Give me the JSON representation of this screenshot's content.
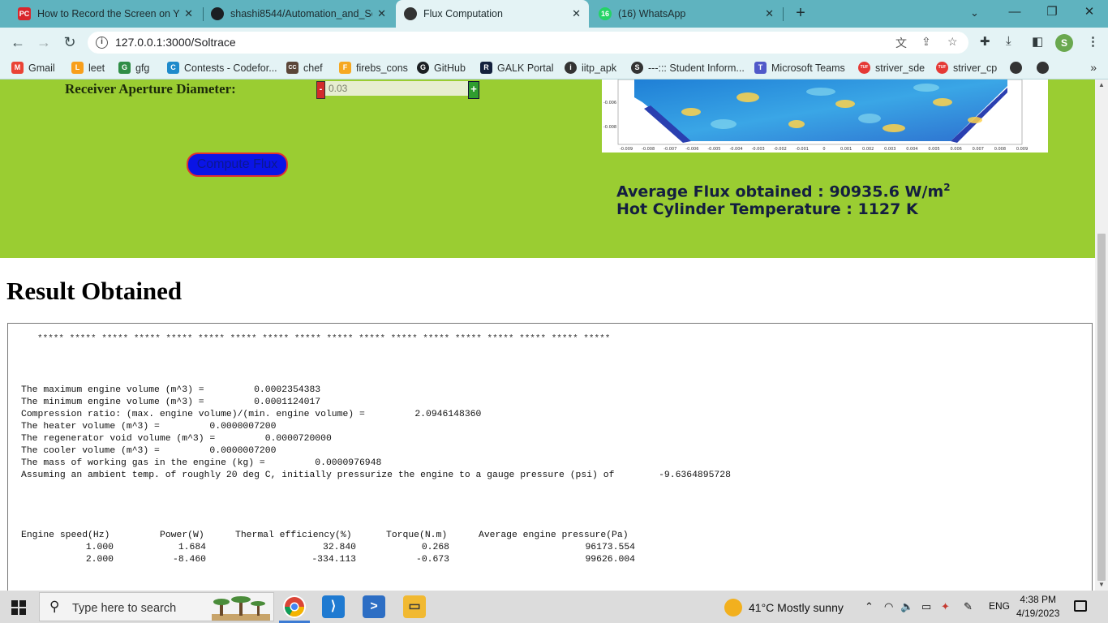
{
  "browser": {
    "tabs": [
      {
        "title": "How to Record the Screen on Yo",
        "favicon_text": "PC",
        "favicon_color": "#d9262c"
      },
      {
        "title": "shashi8544/Automation_and_Sol",
        "favicon_text": "",
        "favicon_color": "#1b1f23"
      },
      {
        "title": "Flux Computation",
        "favicon_text": "",
        "favicon_color": "#333333"
      },
      {
        "title": "(16) WhatsApp",
        "favicon_text": "16",
        "favicon_color": "#25d366"
      }
    ],
    "url": "127.0.0.1:3000/Soltrace",
    "profile_initial": "S",
    "bookmarks": [
      {
        "label": "Gmail",
        "icon": "M",
        "color": "#ea4335"
      },
      {
        "label": "leet",
        "icon": "L",
        "color": "#f89f1b"
      },
      {
        "label": "gfg",
        "icon": "G",
        "color": "#2f8d46"
      },
      {
        "label": "Contests - Codefor...",
        "icon": "C",
        "color": "#1f8acb"
      },
      {
        "label": "chef",
        "icon": "CC",
        "color": "#5b4638"
      },
      {
        "label": "firebs_cons",
        "icon": "F",
        "color": "#f6a821"
      },
      {
        "label": "GitHub",
        "icon": "G",
        "color": "#1b1f23"
      },
      {
        "label": "GALK Portal",
        "icon": "R",
        "color": "#14213d"
      },
      {
        "label": "iitp_apk",
        "icon": "i",
        "color": "#333333"
      },
      {
        "label": "---::: Student Inform...",
        "icon": "S",
        "color": "#333333"
      },
      {
        "label": "Microsoft Teams",
        "icon": "T",
        "color": "#5059c9"
      },
      {
        "label": "striver_sde",
        "icon": "TUF",
        "color": "#e53935"
      },
      {
        "label": "striver_cp",
        "icon": "TUF",
        "color": "#e53935"
      }
    ]
  },
  "form": {
    "aperture_label": "Receiver Aperture Diameter:",
    "aperture_value": "0.03",
    "stepper_minus": "-",
    "stepper_plus": "+",
    "compute_button": "Compute Flux"
  },
  "plot": {
    "y_ticks": [
      "-0.006",
      "-0.008"
    ],
    "x_ticks": [
      "-0.009",
      "-0.008",
      "-0.007",
      "-0.006",
      "-0.005",
      "-0.004",
      "-0.003",
      "-0.002",
      "-0.001",
      "0",
      "0.001",
      "0.002",
      "0.003",
      "0.004",
      "0.005",
      "0.006",
      "0.007",
      "0.008",
      "0.009"
    ]
  },
  "metrics": {
    "avg_flux": "Average Flux obtained : 90935.6 W/m",
    "avg_flux_sup": "2",
    "hot_cyl": "Hot Cylinder Temperature : 1127 K"
  },
  "result": {
    "heading": "Result Obtained",
    "stars": "***** ***** ***** ***** ***** ***** ***** ***** ***** ***** ***** ***** ***** ***** ***** ***** ***** *****",
    "lines": [
      "The maximum engine volume (m^3) =         0.0002354383",
      "The minimum engine volume (m^3) =         0.0001124017",
      "Compression ratio: (max. engine volume)/(min. engine volume) =         2.0946148360",
      "The heater volume (m^3) =         0.0000007200",
      "The regenerator void volume (m^3) =         0.0000720000",
      "The cooler volume (m^3) =         0.0000007200",
      "The mass of working gas in the engine (kg) =         0.0000976948",
      "Assuming an ambient temp. of roughly 20 deg C, initially pressurize the engine to a gauge pressure (psi) of        -9.6364895728"
    ],
    "table": {
      "headers": [
        "Engine speed(Hz)",
        "Power(W)",
        "Thermal efficiency(%)",
        "Torque(N.m)",
        "Average engine pressure(Pa)"
      ],
      "rows": [
        [
          "1.000",
          "1.684",
          "32.840",
          "0.268",
          "96173.554"
        ],
        [
          "2.000",
          "-8.460",
          "-334.113",
          "-0.673",
          "99626.004"
        ]
      ]
    }
  },
  "taskbar": {
    "search_placeholder": "Type here to search",
    "weather": "41°C  Mostly sunny",
    "lang": "ENG",
    "time": "4:38 PM",
    "date": "4/19/2023"
  }
}
